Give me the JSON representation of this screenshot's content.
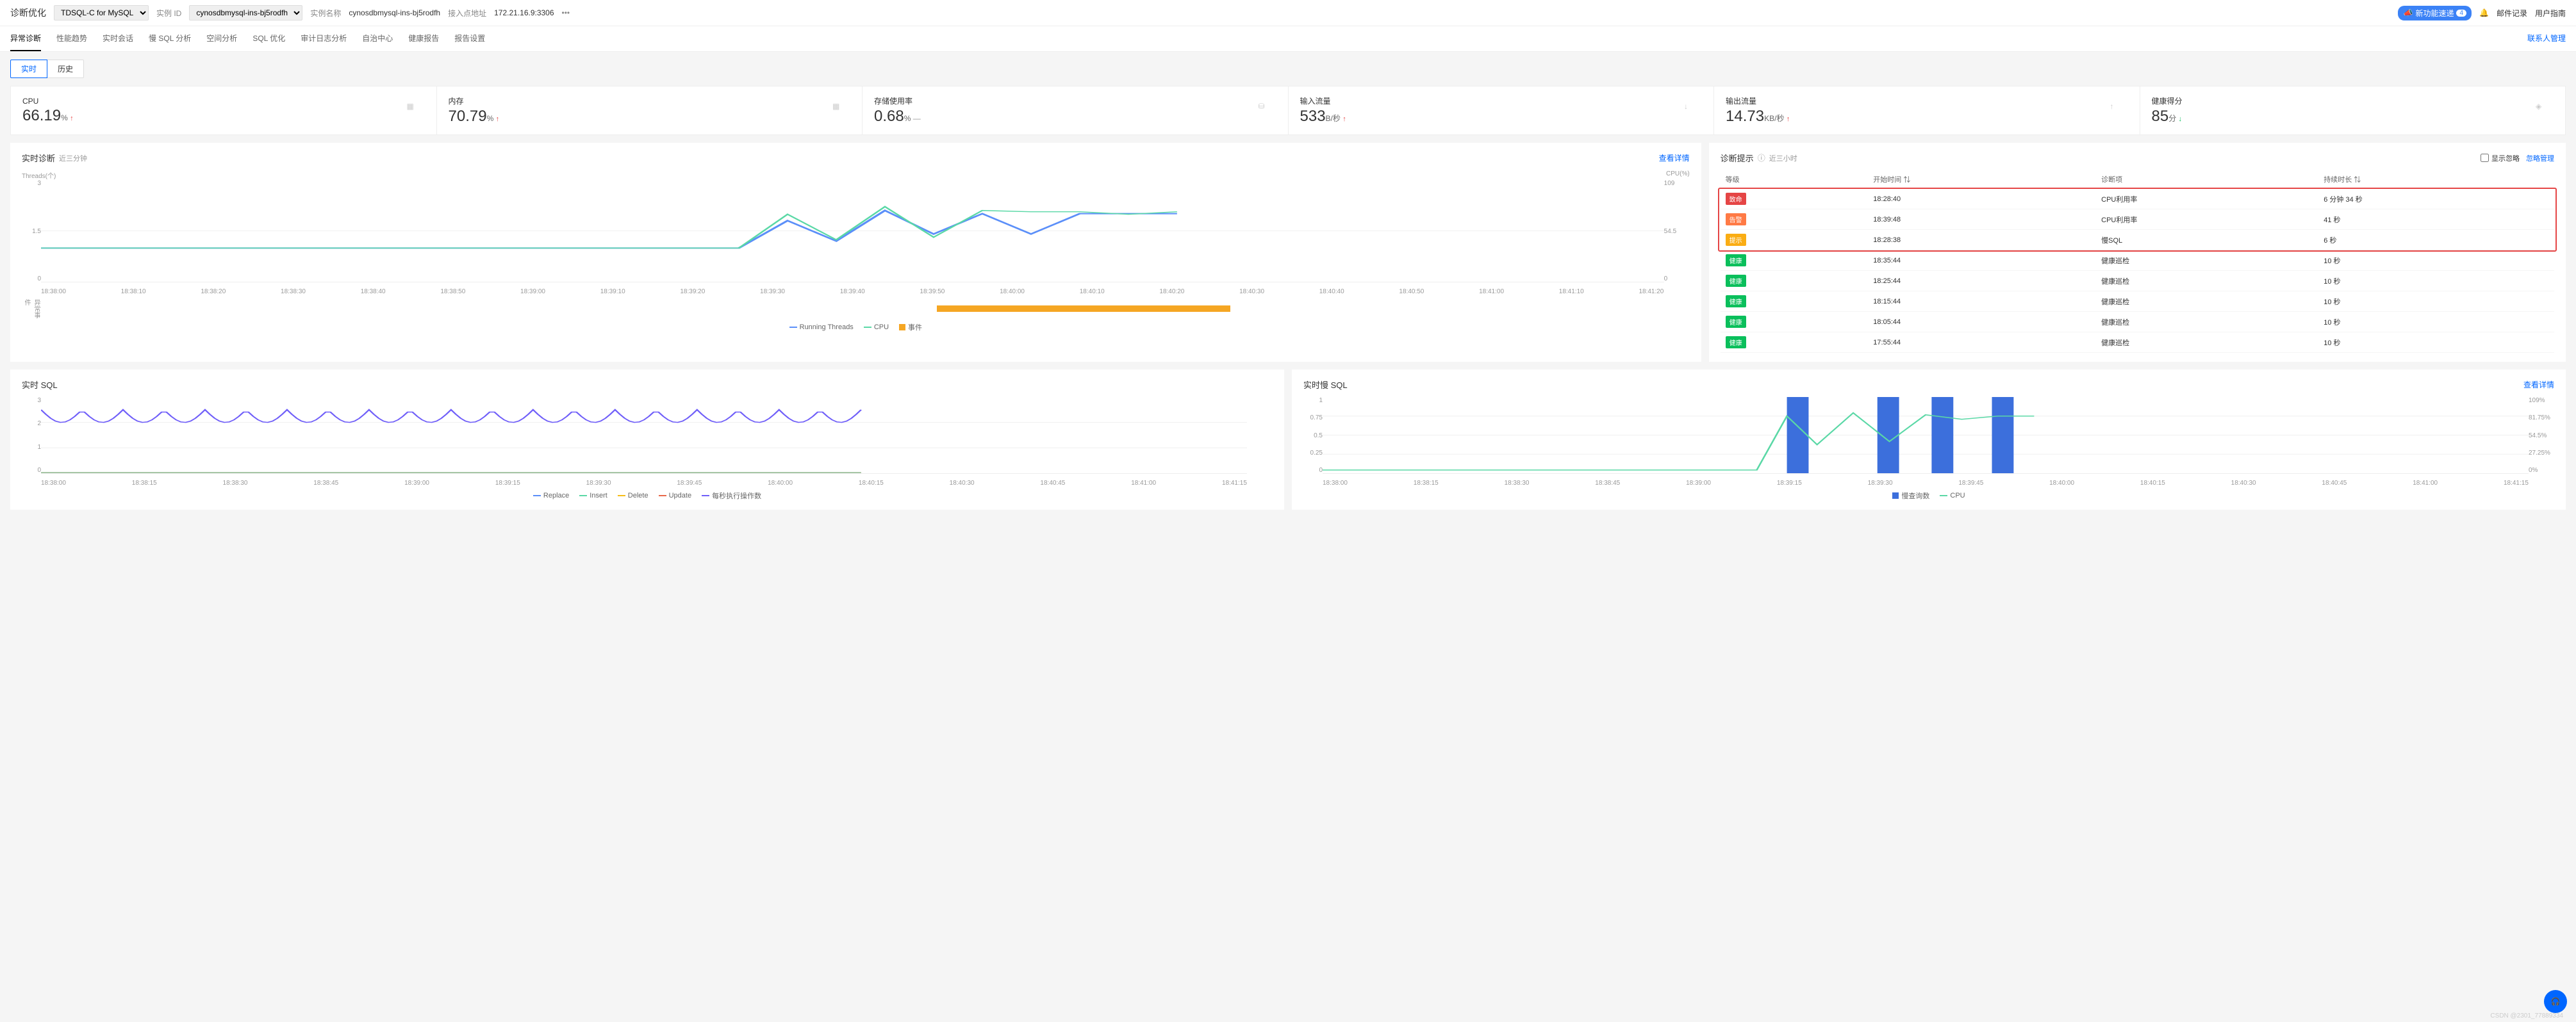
{
  "topbar": {
    "title": "诊断优化",
    "dbtype": "TDSQL-C for MySQL",
    "instance_id_label": "实例 ID",
    "instance_id": "cynosdbmysql-ins-bj5rodfh",
    "instance_name_label": "实例名称",
    "instance_name": "cynosdbmysql-ins-bj5rodfh",
    "endpoint_label": "接入点地址",
    "endpoint": "172.21.16.9:3306",
    "new_feature": "新功能速递",
    "new_count": "4",
    "mail_log": "邮件记录",
    "guide": "用户指南"
  },
  "tabs": {
    "items": [
      "异常诊断",
      "性能趋势",
      "实时会话",
      "慢 SQL 分析",
      "空间分析",
      "SQL 优化",
      "审计日志分析",
      "自治中心",
      "健康报告",
      "报告设置"
    ],
    "contact": "联系人管理"
  },
  "subtabs": {
    "realtime": "实时",
    "history": "历史"
  },
  "metrics": [
    {
      "label": "CPU",
      "value": "66.19",
      "unit": "%",
      "trend": "up"
    },
    {
      "label": "内存",
      "value": "70.79",
      "unit": "%",
      "trend": "up"
    },
    {
      "label": "存储使用率",
      "value": "0.68",
      "unit": "%",
      "trend": "flat"
    },
    {
      "label": "输入流量",
      "value": "533",
      "unit": "B/秒",
      "trend": "up"
    },
    {
      "label": "输出流量",
      "value": "14.73",
      "unit": "KB/秒",
      "trend": "up"
    },
    {
      "label": "健康得分",
      "value": "85",
      "unit": "分",
      "trend": "down"
    }
  ],
  "realtime_diag": {
    "title": "实时诊断",
    "sub": "近三分钟",
    "detail": "查看详情",
    "y_left_label": "Threads(个)",
    "y_right_label": "CPU(%)",
    "legend": [
      "Running Threads",
      "CPU",
      "事件"
    ],
    "event_label": "异常事件"
  },
  "diag_hint": {
    "title": "诊断提示",
    "sub": "近三小时",
    "show_ignore": "显示忽略",
    "ignore_mgmt": "忽略管理",
    "cols": {
      "level": "等级",
      "start": "开始时间",
      "item": "诊断项",
      "duration": "持续时长"
    },
    "rows": [
      {
        "lvl": "fatal",
        "lvl_txt": "致命",
        "time": "18:28:40",
        "item": "CPU利用率",
        "dur": "6 分钟 34 秒",
        "hl": true
      },
      {
        "lvl": "warn",
        "lvl_txt": "告警",
        "time": "18:39:48",
        "item": "CPU利用率",
        "dur": "41 秒",
        "hl": true
      },
      {
        "lvl": "hint",
        "lvl_txt": "提示",
        "time": "18:28:38",
        "item": "慢SQL",
        "dur": "6 秒",
        "hl": true
      },
      {
        "lvl": "ok",
        "lvl_txt": "健康",
        "time": "18:35:44",
        "item": "健康巡检",
        "dur": "10 秒"
      },
      {
        "lvl": "ok",
        "lvl_txt": "健康",
        "time": "18:25:44",
        "item": "健康巡检",
        "dur": "10 秒"
      },
      {
        "lvl": "ok",
        "lvl_txt": "健康",
        "time": "18:15:44",
        "item": "健康巡检",
        "dur": "10 秒"
      },
      {
        "lvl": "ok",
        "lvl_txt": "健康",
        "time": "18:05:44",
        "item": "健康巡检",
        "dur": "10 秒"
      },
      {
        "lvl": "ok",
        "lvl_txt": "健康",
        "time": "17:55:44",
        "item": "健康巡检",
        "dur": "10 秒"
      }
    ]
  },
  "realtime_sql": {
    "title": "实时 SQL",
    "legend": [
      "Replace",
      "Insert",
      "Delete",
      "Update",
      "每秒执行操作数"
    ]
  },
  "slow_sql": {
    "title": "实时慢 SQL",
    "detail": "查看详情",
    "legend": [
      "慢查询数",
      "CPU"
    ]
  },
  "chart_data": [
    {
      "id": "realtime_diag",
      "type": "line",
      "x_ticks": [
        "18:38:00",
        "18:38:10",
        "18:38:20",
        "18:38:30",
        "18:38:40",
        "18:38:50",
        "18:39:00",
        "18:39:10",
        "18:39:20",
        "18:39:30",
        "18:39:40",
        "18:39:50",
        "18:40:00",
        "18:40:10",
        "18:40:20",
        "18:40:30",
        "18:40:40",
        "18:40:50",
        "18:41:00",
        "18:41:10",
        "18:41:20"
      ],
      "ylim_left": [
        0,
        3
      ],
      "y_left_ticks": [
        0,
        1.5,
        3
      ],
      "ylim_right": [
        0,
        109
      ],
      "y_right_ticks": [
        0,
        54.5,
        109
      ],
      "series": [
        {
          "name": "Running Threads",
          "axis": "left",
          "color": "#5b8ff9",
          "values": [
            1,
            1,
            1,
            1,
            1,
            1,
            1,
            1,
            1,
            1.8,
            1.2,
            2.1,
            1.4,
            2.0,
            2.0,
            null,
            null,
            null,
            null,
            null,
            null
          ]
        },
        {
          "name": "CPU",
          "axis": "right",
          "color": "#5ad8a6",
          "values": [
            36,
            36,
            36,
            36,
            36,
            36,
            36,
            36,
            40,
            72,
            45,
            80,
            48,
            75,
            72,
            null,
            null,
            null,
            null,
            null,
            null
          ]
        }
      ],
      "event_block": {
        "start_frac": 0.55,
        "end_frac": 0.73,
        "color": "#f5a623"
      }
    },
    {
      "id": "realtime_sql",
      "type": "line",
      "x_ticks": [
        "18:38:00",
        "18:38:15",
        "18:38:30",
        "18:38:45",
        "18:39:00",
        "18:39:15",
        "18:39:30",
        "18:39:45",
        "18:40:00",
        "18:40:15",
        "18:40:30",
        "18:40:45",
        "18:41:00",
        "18:41:15"
      ],
      "ylim": [
        0,
        3
      ],
      "y_ticks": [
        0,
        1,
        2,
        3
      ],
      "series": [
        {
          "name": "Replace",
          "color": "#5b8ff9",
          "values": [
            0,
            0,
            0,
            0,
            0,
            0,
            0,
            0,
            0,
            0,
            null,
            null,
            null,
            null
          ]
        },
        {
          "name": "Insert",
          "color": "#5ad8a6",
          "values": [
            0,
            0,
            0,
            0,
            0,
            0,
            0,
            0,
            0,
            0,
            null,
            null,
            null,
            null
          ]
        },
        {
          "name": "Delete",
          "color": "#f6bd16",
          "values": [
            0,
            0,
            0,
            0,
            0,
            0,
            0,
            0,
            0,
            0,
            null,
            null,
            null,
            null
          ]
        },
        {
          "name": "Update",
          "color": "#e8684a",
          "values": [
            0,
            0,
            0,
            0,
            0,
            0,
            0,
            0,
            0,
            0,
            null,
            null,
            null,
            null
          ]
        },
        {
          "name": "每秒执行操作数",
          "color": "#6f5ef9",
          "values": [
            3,
            2,
            3,
            2,
            3,
            2,
            3,
            2,
            3,
            2,
            null,
            null,
            null,
            null
          ],
          "oscillate": true
        }
      ]
    },
    {
      "id": "slow_sql",
      "type": "bar+line",
      "x_ticks": [
        "18:38:00",
        "18:38:15",
        "18:38:30",
        "18:38:45",
        "18:39:00",
        "18:39:15",
        "18:39:30",
        "18:39:45",
        "18:40:00",
        "18:40:15",
        "18:40:30",
        "18:40:45",
        "18:41:00",
        "18:41:15"
      ],
      "ylim_left": [
        0,
        1
      ],
      "y_left_ticks": [
        0,
        0.25,
        0.5,
        0.75,
        1
      ],
      "ylim_right": [
        0,
        109
      ],
      "y_right_ticks": [
        "0%",
        "27.25%",
        "54.5%",
        "81.75%",
        "109%"
      ],
      "series": [
        {
          "name": "慢查询数",
          "type": "bar",
          "color": "#3c6fdc",
          "values": [
            0,
            0,
            0,
            0,
            0,
            1,
            0,
            1,
            1,
            null,
            null,
            null,
            null,
            null
          ],
          "bars_at": [
            5,
            6.5,
            7.5,
            8
          ]
        },
        {
          "name": "CPU",
          "type": "line",
          "color": "#5ad8a6",
          "values": [
            5,
            5,
            5,
            5,
            5,
            75,
            40,
            82,
            70,
            null,
            null,
            null,
            null,
            null
          ]
        }
      ]
    }
  ],
  "watermark": "CSDN @2301_77889334"
}
